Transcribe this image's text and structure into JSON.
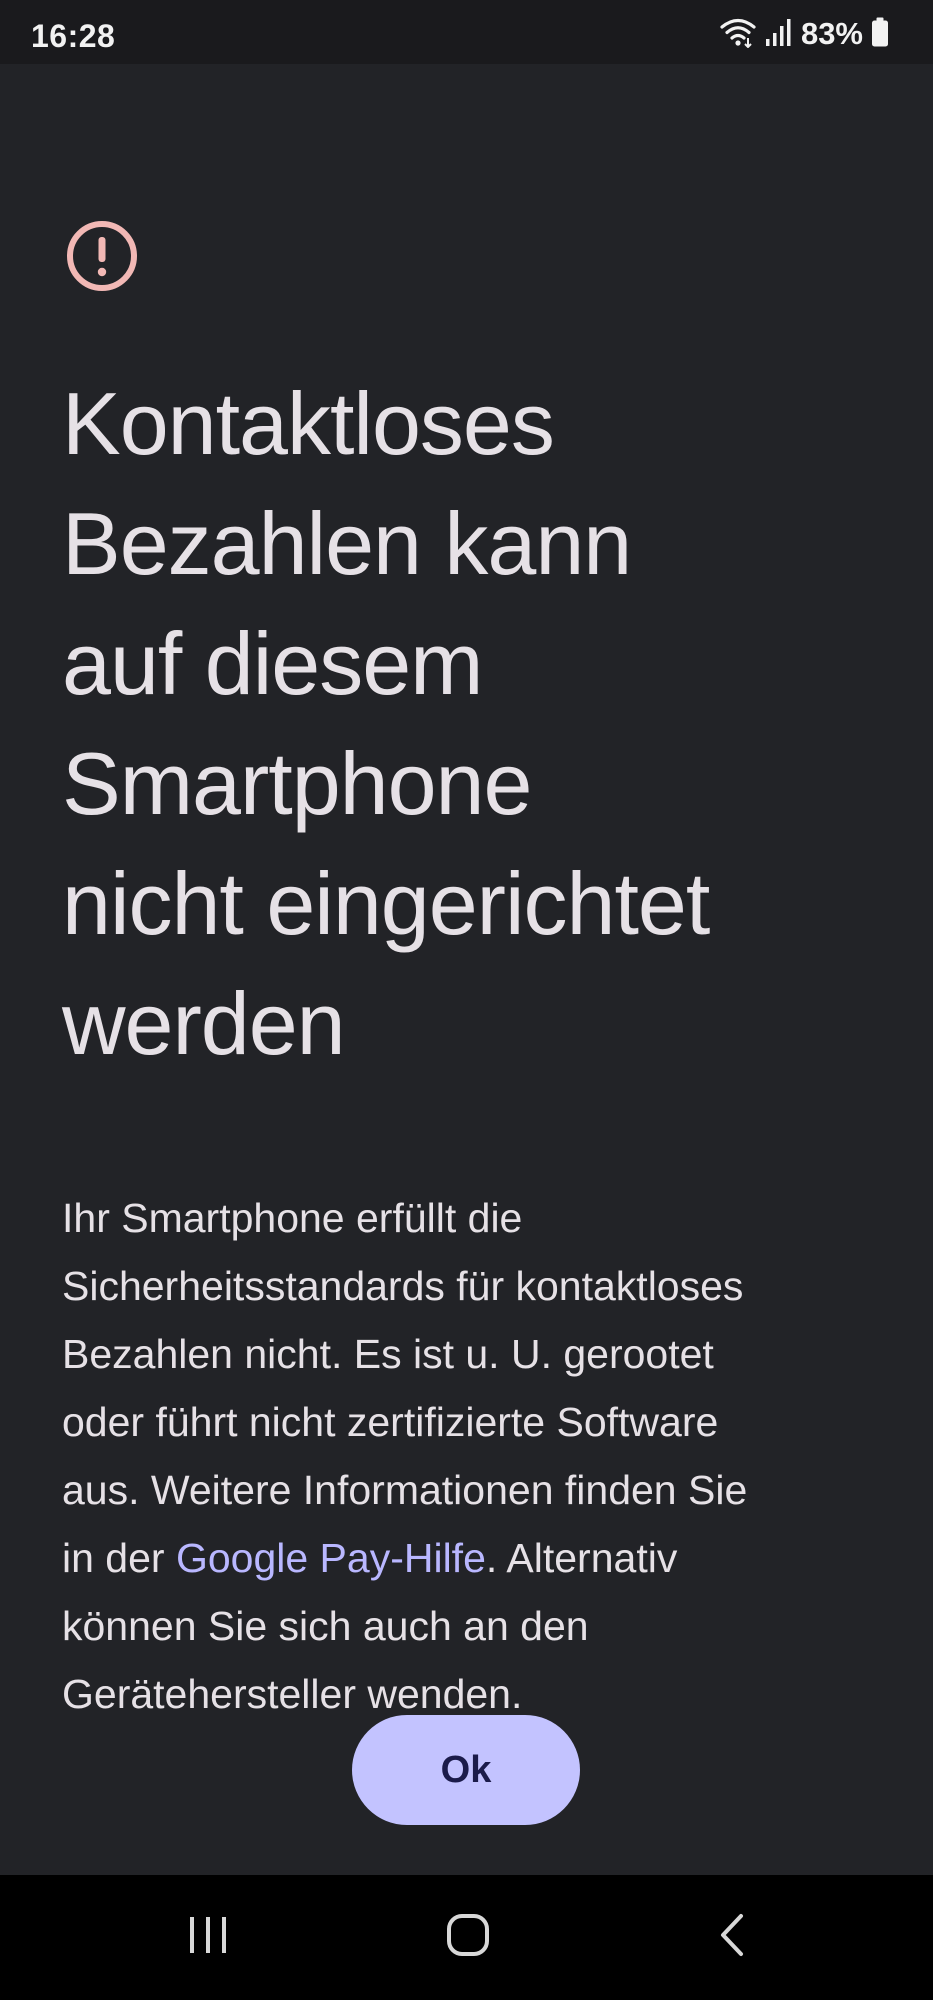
{
  "status_bar": {
    "time": "16:28",
    "battery_text": "83%",
    "icons": [
      "wifi-icon",
      "signal-icon",
      "battery-icon"
    ]
  },
  "dialog": {
    "icon": "warning-circle-icon",
    "icon_color": "#f2b8b5",
    "title_lines": [
      "Kontaktloses",
      "Bezahlen kann",
      "auf diesem",
      "Smartphone",
      "nicht eingerichtet",
      "werden"
    ],
    "body": {
      "line1": "Ihr Smartphone erfüllt die",
      "line2": "Sicherheitsstandards für kontaktloses",
      "line3": "Bezahlen nicht. Es ist u. U. gerootet",
      "line4": "oder führt nicht zertifizierte Software",
      "line5": "aus. Weitere Informationen finden Sie",
      "line6_before": "in der ",
      "link_text": "Google Pay-Hilfe",
      "line6_after": ". Alternativ",
      "line7": "können Sie sich auch an den",
      "line8": "Gerätehersteller wenden."
    },
    "ok_label": "Ok",
    "accent_color": "#c3c3ff",
    "link_color": "#b9b7ff"
  },
  "nav_bar": {
    "buttons": [
      "recent-apps-icon",
      "home-icon",
      "back-icon"
    ]
  }
}
